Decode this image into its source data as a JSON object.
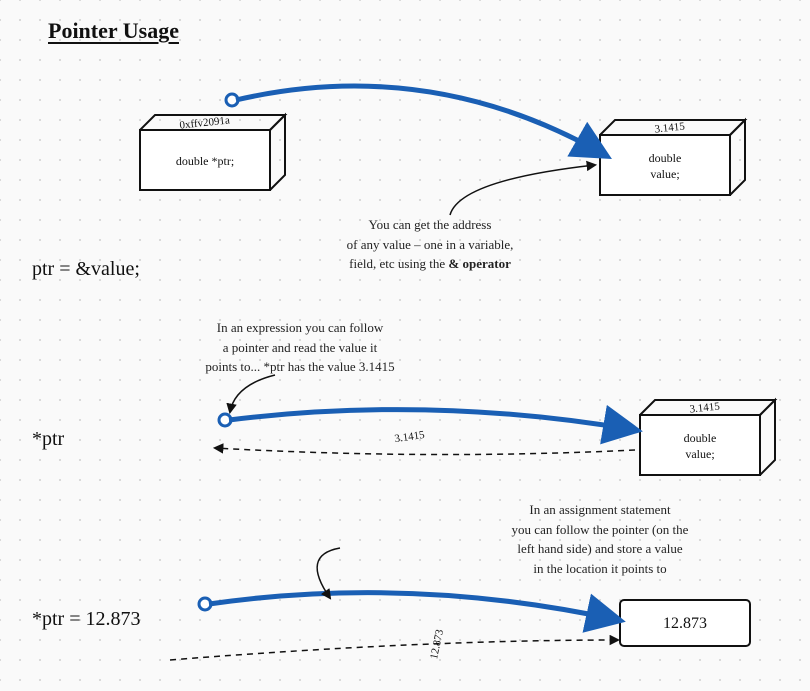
{
  "title": "Pointer Usage",
  "section1": {
    "ptr_box": {
      "label": "double *ptr;",
      "top_value": "0xffv2091a"
    },
    "value_box": {
      "label": "double value;",
      "top_value": "3.1415"
    },
    "note_line1": "You can get the address",
    "note_line2": "of any value – one in a variable,",
    "note_line3": "field, etc using the ",
    "note_bold": "& operator",
    "code": "ptr = &value;"
  },
  "section2": {
    "note_line1": "In an expression you can follow",
    "note_line2": "a pointer and read the value it",
    "note_line3": "points to... *ptr has the value 3.1415",
    "code": "*ptr",
    "value_box": {
      "label": "double value;",
      "top_value": "3.1415"
    },
    "flow_value": "3.1415"
  },
  "section3": {
    "note_line1": "In an assignment statement",
    "note_line2": "you can follow the pointer (on the",
    "note_line3": "left hand side) and store a value",
    "note_line4": "in the location it points to",
    "code": "*ptr = 12.873",
    "box_value": "12.873",
    "flow_value": "12.873"
  }
}
